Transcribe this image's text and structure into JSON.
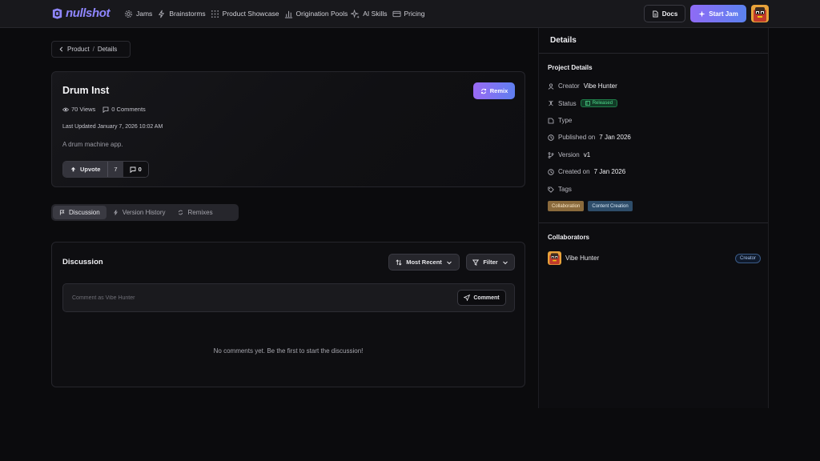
{
  "app": {
    "logo_text": "nullshot",
    "brand_color": "#8f86ff",
    "accent_gradient": [
      "#8f6bf5",
      "#5b82f0"
    ]
  },
  "nav": {
    "items": [
      {
        "label": "Jams",
        "icon": "gear-icon"
      },
      {
        "label": "Brainstorms",
        "icon": "lightning-icon"
      },
      {
        "label": "Product Showcase",
        "icon": "grid-icon"
      },
      {
        "label": "Origination Pools",
        "icon": "bar-chart-icon"
      },
      {
        "label": "AI Skills",
        "icon": "sparkles-icon"
      },
      {
        "label": "Pricing",
        "icon": "credit-card-icon"
      }
    ],
    "docs_label": "Docs",
    "start_jam_label": "Start Jam"
  },
  "breadcrumb": {
    "parent": "Product",
    "separator": "/",
    "current": "Details"
  },
  "project": {
    "title": "Drum Inst",
    "remix_label": "Remix",
    "views": "70 Views",
    "comments": "0 Comments",
    "last_updated": "Last Updated January 7, 2026 10:02 AM",
    "description": "A drum machine app.",
    "upvote_label": "Upvote",
    "upvote_count": "7",
    "comment_count": "0"
  },
  "tabs": [
    {
      "label": "Discussion",
      "icon": "flag-icon",
      "active": true
    },
    {
      "label": "Version History",
      "icon": "lightning-icon",
      "active": false
    },
    {
      "label": "Remixes",
      "icon": "refresh-icon",
      "active": false
    }
  ],
  "discussion": {
    "title": "Discussion",
    "sort_label": "Most Recent",
    "filter_label": "Filter",
    "input_placeholder": "Comment as Vibe Hunter",
    "input_value": "",
    "comment_button_label": "Comment",
    "empty_message": "No comments yet. Be the first to start the discussion!"
  },
  "details": {
    "header": "Details",
    "section_title": "Project Details",
    "creator_label": "Creator",
    "creator_value": "Vibe Hunter",
    "status_label": "Status",
    "status_value": "Released",
    "status_color": "#4fdc8e",
    "type_label": "Type",
    "published_label": "Published on",
    "published_value": "7 Jan 2026",
    "version_label": "Version",
    "version_value": "v1",
    "created_label": "Created on",
    "created_value": "7 Jan 2026",
    "tags_label": "Tags",
    "tags": [
      "Collaboration",
      "Content Creation"
    ],
    "collaborators_title": "Collaborators",
    "collaborators": [
      {
        "name": "Vibe Hunter",
        "role": "Creator"
      }
    ]
  }
}
